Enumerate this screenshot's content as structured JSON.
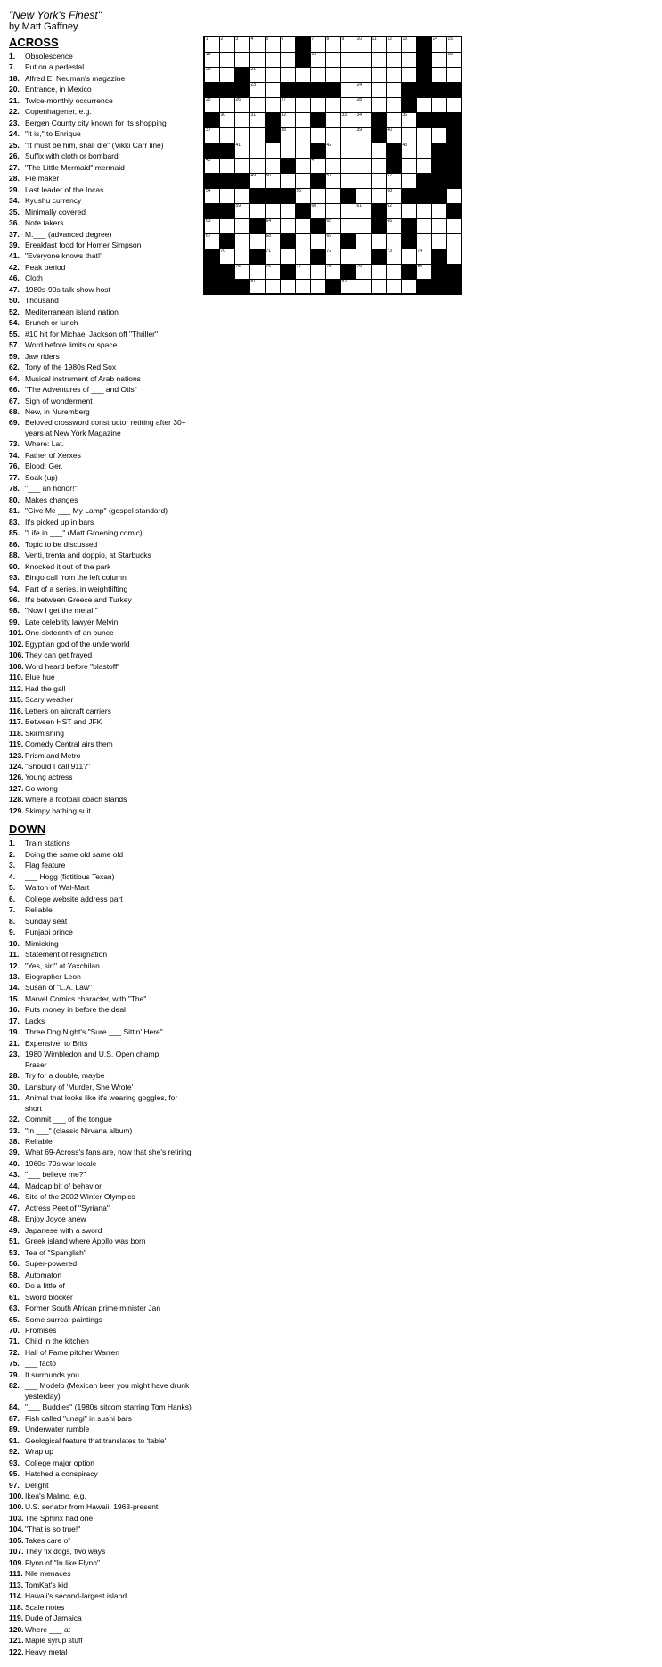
{
  "header": {
    "title": "\"New York's Finest\"",
    "author": "by Matt Gaffney"
  },
  "across_label": "ACROSS",
  "down_label": "DOWN",
  "across_clues": [
    {
      "num": "1",
      "text": "Obsolescence"
    },
    {
      "num": "7",
      "text": "Put on a pedestal"
    },
    {
      "num": "18",
      "text": "Alfred E. Neuman's magazine"
    },
    {
      "num": "20",
      "text": "Entrance, in Mexico"
    },
    {
      "num": "21",
      "text": "Twice-monthly occurrence"
    },
    {
      "num": "22",
      "text": "Copenhagener, e.g."
    },
    {
      "num": "23",
      "text": "Bergen County city known for its shopping"
    },
    {
      "num": "24",
      "text": "\"It is,\" to Enrique"
    },
    {
      "num": "25",
      "text": "\"It must be him, shall die\" (Vikki Carr line)"
    },
    {
      "num": "26",
      "text": "Suffix with cloth or bombard"
    },
    {
      "num": "27",
      "text": "\"The Little Mermaid\" mermaid"
    },
    {
      "num": "28",
      "text": "Pie maker"
    },
    {
      "num": "29",
      "text": "Last leader of the Incas"
    },
    {
      "num": "34",
      "text": "Kyushu currency"
    },
    {
      "num": "35",
      "text": "Minimally covered"
    },
    {
      "num": "36",
      "text": "Note takers"
    },
    {
      "num": "37",
      "text": "M.___ (advanced degree)"
    },
    {
      "num": "39",
      "text": "Breakfast food for Homer Simpson"
    },
    {
      "num": "41",
      "text": "\"Everyone knows that!\""
    },
    {
      "num": "42",
      "text": "Peak period"
    },
    {
      "num": "46",
      "text": "Cloth"
    },
    {
      "num": "47",
      "text": "1980s-90s talk show host"
    },
    {
      "num": "50",
      "text": "Thousand"
    },
    {
      "num": "52",
      "text": "Mediterranean island nation"
    },
    {
      "num": "54",
      "text": "Brunch or lunch"
    },
    {
      "num": "55",
      "text": "#10 hit for Michael Jackson off \"Thriller\""
    },
    {
      "num": "57",
      "text": "Word before limits or space"
    },
    {
      "num": "59",
      "text": "Jaw riders"
    },
    {
      "num": "62",
      "text": "Tony of the 1980s Red Sox"
    },
    {
      "num": "64",
      "text": "Musical instrument of Arab nations"
    },
    {
      "num": "66",
      "text": "\"The Adventures of ___ and Otis\""
    },
    {
      "num": "67",
      "text": "Sigh of wonderment"
    },
    {
      "num": "68",
      "text": "New, in Nuremberg"
    },
    {
      "num": "69",
      "text": "Beloved crossword constructor retiring after 30+ years at New York Magazine"
    },
    {
      "num": "73",
      "text": "Where: Lat."
    },
    {
      "num": "74",
      "text": "Father of Xerxes"
    },
    {
      "num": "76",
      "text": "Blood: Ger."
    },
    {
      "num": "77",
      "text": "Soak (up)"
    },
    {
      "num": "78",
      "text": "\"___ an honor!\""
    },
    {
      "num": "80",
      "text": "Makes changes"
    },
    {
      "num": "81",
      "text": "\"Give Me ___ My Lamp\" (gospel standard)"
    },
    {
      "num": "83",
      "text": "It's picked up in bars"
    },
    {
      "num": "85",
      "text": "\"Life in ___\" (Matt Groening comic)"
    },
    {
      "num": "86",
      "text": "Topic to be discussed"
    },
    {
      "num": "88",
      "text": "Venti, trenta and doppio, at Starbucks"
    },
    {
      "num": "90",
      "text": "Knocked it out of the park"
    },
    {
      "num": "93",
      "text": "Bingo call from the left column"
    },
    {
      "num": "94",
      "text": "Part of a series, in weightlifting"
    },
    {
      "num": "96",
      "text": "It's between Greece and Turkey"
    },
    {
      "num": "98",
      "text": "\"Now I get the metal!\""
    },
    {
      "num": "99",
      "text": "Late celebrity lawyer Melvin"
    },
    {
      "num": "101",
      "text": "One-sixteenth of an ounce"
    },
    {
      "num": "102",
      "text": "Egyptian god of the underworld"
    },
    {
      "num": "106",
      "text": "They can get frayed"
    },
    {
      "num": "108",
      "text": "Word heard before \"blastoff\""
    },
    {
      "num": "110",
      "text": "Blue hue"
    },
    {
      "num": "112",
      "text": "Had the gall"
    },
    {
      "num": "115",
      "text": "Scary weather"
    },
    {
      "num": "116",
      "text": "Letters on aircraft carriers"
    },
    {
      "num": "117",
      "text": "Between HST and JFK"
    },
    {
      "num": "118",
      "text": "Skirmishing"
    },
    {
      "num": "119",
      "text": "Comedy Central airs them"
    },
    {
      "num": "123",
      "text": "Prism and Metro"
    },
    {
      "num": "124",
      "text": "\"Should I call 911?\""
    },
    {
      "num": "126",
      "text": "Young actress"
    },
    {
      "num": "127",
      "text": "Go wrong"
    },
    {
      "num": "128",
      "text": "Where a football coach stands"
    },
    {
      "num": "129",
      "text": "Skimpy bathing suit"
    }
  ],
  "down_clues": [
    {
      "num": "1",
      "text": "Train stations"
    },
    {
      "num": "2",
      "text": "Doing the same old same old"
    },
    {
      "num": "3",
      "text": "Flag feature"
    },
    {
      "num": "4",
      "text": "___ Hogg (fictitious Texan)"
    },
    {
      "num": "5",
      "text": "Walton of Wal-Mart"
    },
    {
      "num": "6",
      "text": "College website address part"
    },
    {
      "num": "7",
      "text": "Reliable"
    },
    {
      "num": "8",
      "text": "Sunday seat"
    },
    {
      "num": "9",
      "text": "Punjabi prince"
    },
    {
      "num": "10",
      "text": "Mimicking"
    },
    {
      "num": "11",
      "text": "Statement of resignation"
    },
    {
      "num": "12",
      "text": "\"Yes, sir!\" at Yaxchilan"
    },
    {
      "num": "13",
      "text": "Biographer Leon"
    },
    {
      "num": "14",
      "text": "Susan of \"L.A. Law\""
    },
    {
      "num": "15",
      "text": "Marvel Comics character, with \"The\""
    },
    {
      "num": "16",
      "text": "Puts money in before the deal"
    },
    {
      "num": "17",
      "text": "Lacks"
    },
    {
      "num": "19",
      "text": "Three Dog Night's \"Sure ___ Sittin' Here\""
    },
    {
      "num": "21",
      "text": "Expensive, to Brits"
    },
    {
      "num": "23",
      "text": "1980 Wimbledon and U.S. Open champ ___ Fraser"
    },
    {
      "num": "28",
      "text": "Try for a double, maybe"
    },
    {
      "num": "30",
      "text": "Lansbury of 'Murder, She Wrote'"
    },
    {
      "num": "31",
      "text": "Animal that looks like it's wearing goggles, for short"
    },
    {
      "num": "32",
      "text": "Commit ___ of the tongue"
    },
    {
      "num": "33",
      "text": "\"In ___\" (classic Nirvana album)"
    },
    {
      "num": "38",
      "text": "Reliable"
    },
    {
      "num": "39",
      "text": "What 69-Across's fans are, now that she's retiring"
    },
    {
      "num": "40",
      "text": "1960s-70s war locale"
    },
    {
      "num": "43",
      "text": "\"___ believe me?\""
    },
    {
      "num": "44",
      "text": "Madcap bit of behavior"
    },
    {
      "num": "46",
      "text": "Site of the 2002 Winter Olympics"
    },
    {
      "num": "47",
      "text": "Actress Peet of \"Syriana\""
    },
    {
      "num": "48",
      "text": "Enjoy Joyce anew"
    },
    {
      "num": "49",
      "text": "Japanese with a sword"
    },
    {
      "num": "51",
      "text": "Greek island where Apollo was born"
    },
    {
      "num": "53",
      "text": "Tea of \"Spanglish\""
    },
    {
      "num": "56",
      "text": "Super-powered"
    },
    {
      "num": "58",
      "text": "Automaton"
    },
    {
      "num": "60",
      "text": "Do a little of"
    },
    {
      "num": "61",
      "text": "Sword blocker"
    },
    {
      "num": "63",
      "text": "Former South African prime minister Jan ___"
    },
    {
      "num": "65",
      "text": "Some surreal paintings"
    },
    {
      "num": "70",
      "text": "Promises"
    },
    {
      "num": "71",
      "text": "Child in the kitchen"
    },
    {
      "num": "72",
      "text": "Hall of Fame pitcher Warren"
    },
    {
      "num": "75",
      "text": "___ facto"
    },
    {
      "num": "79",
      "text": "It surrounds you"
    },
    {
      "num": "82",
      "text": "___ Modelo (Mexican beer you might have drunk yesterday)"
    },
    {
      "num": "84",
      "text": "\"___ Buddies\" (1980s sitcom starring Tom Hanks)"
    },
    {
      "num": "87",
      "text": "Fish called \"unagi\" in sushi bars"
    },
    {
      "num": "89",
      "text": "Underwater rumble"
    },
    {
      "num": "91",
      "text": "Geological feature that translates to 'table'"
    },
    {
      "num": "92",
      "text": "Wrap up"
    },
    {
      "num": "93",
      "text": "College major option"
    },
    {
      "num": "95",
      "text": "Hatched a conspiracy"
    },
    {
      "num": "97",
      "text": "Delight"
    },
    {
      "num": "100",
      "text": "Ikea's Malmo, e.g."
    },
    {
      "num": "100",
      "text": "U.S. senator from Hawaii, 1963-present"
    },
    {
      "num": "103",
      "text": "The Sphinx had one"
    },
    {
      "num": "104",
      "text": "\"That is so true!\""
    },
    {
      "num": "105",
      "text": "Takes care of"
    },
    {
      "num": "107",
      "text": "They fix dogs, two ways"
    },
    {
      "num": "109",
      "text": "Flynn of \"In like Flynn\""
    },
    {
      "num": "111",
      "text": "Nile menaces"
    },
    {
      "num": "113",
      "text": "TomKat's kid"
    },
    {
      "num": "114",
      "text": "Hawaii's second-largest island"
    },
    {
      "num": "118",
      "text": "Scale notes"
    },
    {
      "num": "119",
      "text": "Dude of Jamaica"
    },
    {
      "num": "120",
      "text": "Where ___ at"
    },
    {
      "num": "121",
      "text": "Maple syrup stuff"
    },
    {
      "num": "122",
      "text": "Heavy metal"
    }
  ]
}
